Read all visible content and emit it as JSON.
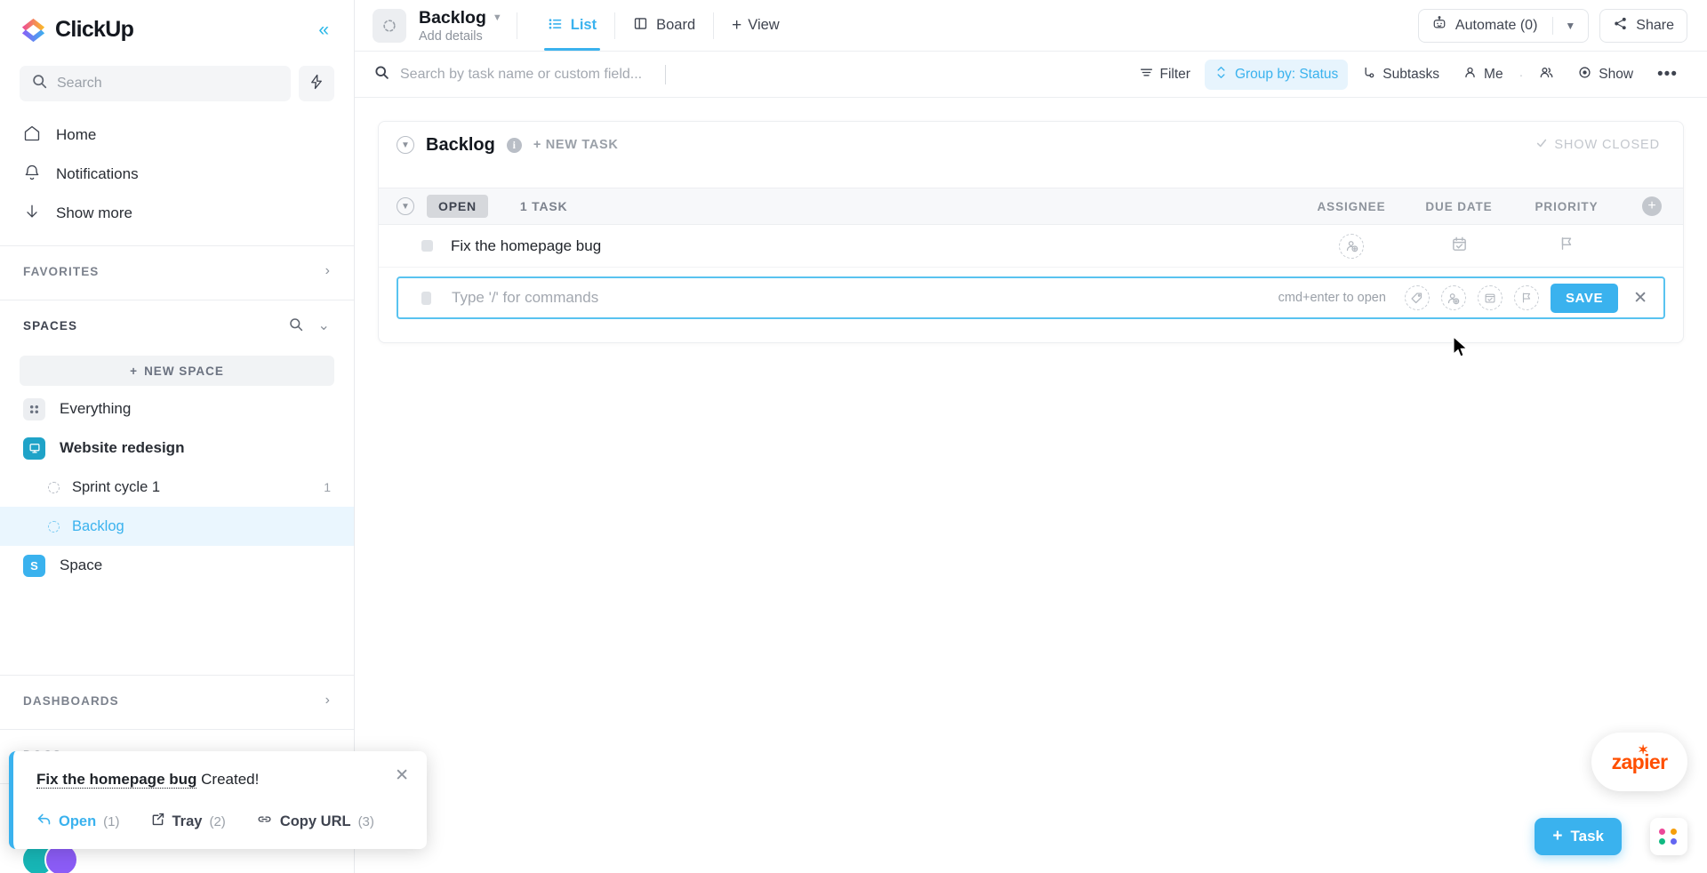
{
  "brand": {
    "name": "ClickUp",
    "collapse_icon": "chevron-double-left-icon"
  },
  "sidebar": {
    "search": {
      "placeholder": "Search",
      "icon": "search-icon"
    },
    "bolt_icon": "lightning-bolt-icon",
    "nav": [
      {
        "label": "Home",
        "icon": "home-icon"
      },
      {
        "label": "Notifications",
        "icon": "bell-icon"
      },
      {
        "label": "Show more",
        "icon": "arrow-down-icon"
      }
    ],
    "favorites": {
      "label": "FAVORITES",
      "chevron": "chevron-right-icon"
    },
    "spaces": {
      "label": "SPACES",
      "search_icon": "search-icon",
      "chevron": "chevron-down-icon",
      "new_space_label": "NEW SPACE",
      "items": [
        {
          "label": "Everything",
          "icon": "grid-icon",
          "kind": "grey",
          "bold": false
        },
        {
          "label": "Website redesign",
          "icon": "monitor-icon",
          "kind": "teal",
          "bold": true
        }
      ],
      "lists": [
        {
          "label": "Sprint cycle 1",
          "count": "1",
          "active": false
        },
        {
          "label": "Backlog",
          "count": "",
          "active": true
        }
      ],
      "space_extra": {
        "label": "Space",
        "initial": "S"
      }
    },
    "dashboards": {
      "label": "DASHBOARDS",
      "chevron": "chevron-right-icon"
    },
    "docs": {
      "label": "DOCS",
      "chevron": "chevron-right-icon"
    }
  },
  "toast": {
    "task_name": "Fix the homepage bug",
    "suffix": " Created!",
    "close_icon": "close-icon",
    "actions": [
      {
        "label": "Open",
        "num": "(1)",
        "icon": "reply-arrow-icon",
        "primary": true
      },
      {
        "label": "Tray",
        "num": "(2)",
        "icon": "tray-icon",
        "primary": false
      },
      {
        "label": "Copy URL",
        "num": "(3)",
        "icon": "link-icon",
        "primary": false
      }
    ]
  },
  "topbar": {
    "view_title": "Backlog",
    "add_details": "Add details",
    "caret_icon": "chevron-down-icon",
    "tabs": [
      {
        "label": "List",
        "icon": "list-icon",
        "active": true
      },
      {
        "label": "Board",
        "icon": "board-icon",
        "active": false
      },
      {
        "label": "View",
        "icon": "plus-icon",
        "active": false
      }
    ],
    "automate": {
      "label": "Automate (0)",
      "icon": "robot-icon",
      "caret": "chevron-down-icon"
    },
    "share": {
      "label": "Share",
      "icon": "share-icon"
    }
  },
  "toolbar": {
    "search_placeholder": "Search by task name or custom field...",
    "search_icon": "search-icon",
    "buttons": [
      {
        "label": "Filter",
        "icon": "filter-icon",
        "active": false
      },
      {
        "label": "Group by: Status",
        "icon": "sort-icon",
        "active": true
      },
      {
        "label": "Subtasks",
        "icon": "subtask-icon",
        "active": false
      },
      {
        "label": "Me",
        "icon": "person-icon",
        "active": false
      }
    ],
    "people_icon": "people-icon",
    "show": {
      "label": "Show",
      "icon": "eye-icon"
    },
    "more_icon": "ellipsis-icon"
  },
  "group": {
    "title": "Backlog",
    "info_icon": "info-icon",
    "new_task_label": "+ NEW TASK",
    "show_closed": "SHOW CLOSED",
    "show_closed_icon": "check-icon",
    "collapse_icon": "chevron-down-circle-icon"
  },
  "table": {
    "status_chip": "OPEN",
    "task_count": "1 TASK",
    "columns": [
      "ASSIGNEE",
      "DUE DATE",
      "PRIORITY"
    ],
    "add_column_icon": "plus-circle-icon",
    "rows": [
      {
        "name": "Fix the homepage bug",
        "assignee_icon": "add-assignee-icon",
        "due_icon": "calendar-icon",
        "priority_icon": "flag-icon"
      }
    ]
  },
  "new_task_input": {
    "placeholder": "Type '/' for commands",
    "hint": "cmd+enter to open",
    "icons": [
      "tag-icon",
      "add-assignee-icon",
      "calendar-icon",
      "flag-icon"
    ],
    "save_label": "SAVE",
    "close_icon": "close-icon"
  },
  "widgets": {
    "zapier_label": "zapier",
    "task_fab_label": "Task",
    "task_fab_icon": "plus-icon",
    "apps_icon": "apps-grid-icon",
    "accent_color": "#3ab2ee",
    "zapier_color": "#ff4f00"
  }
}
